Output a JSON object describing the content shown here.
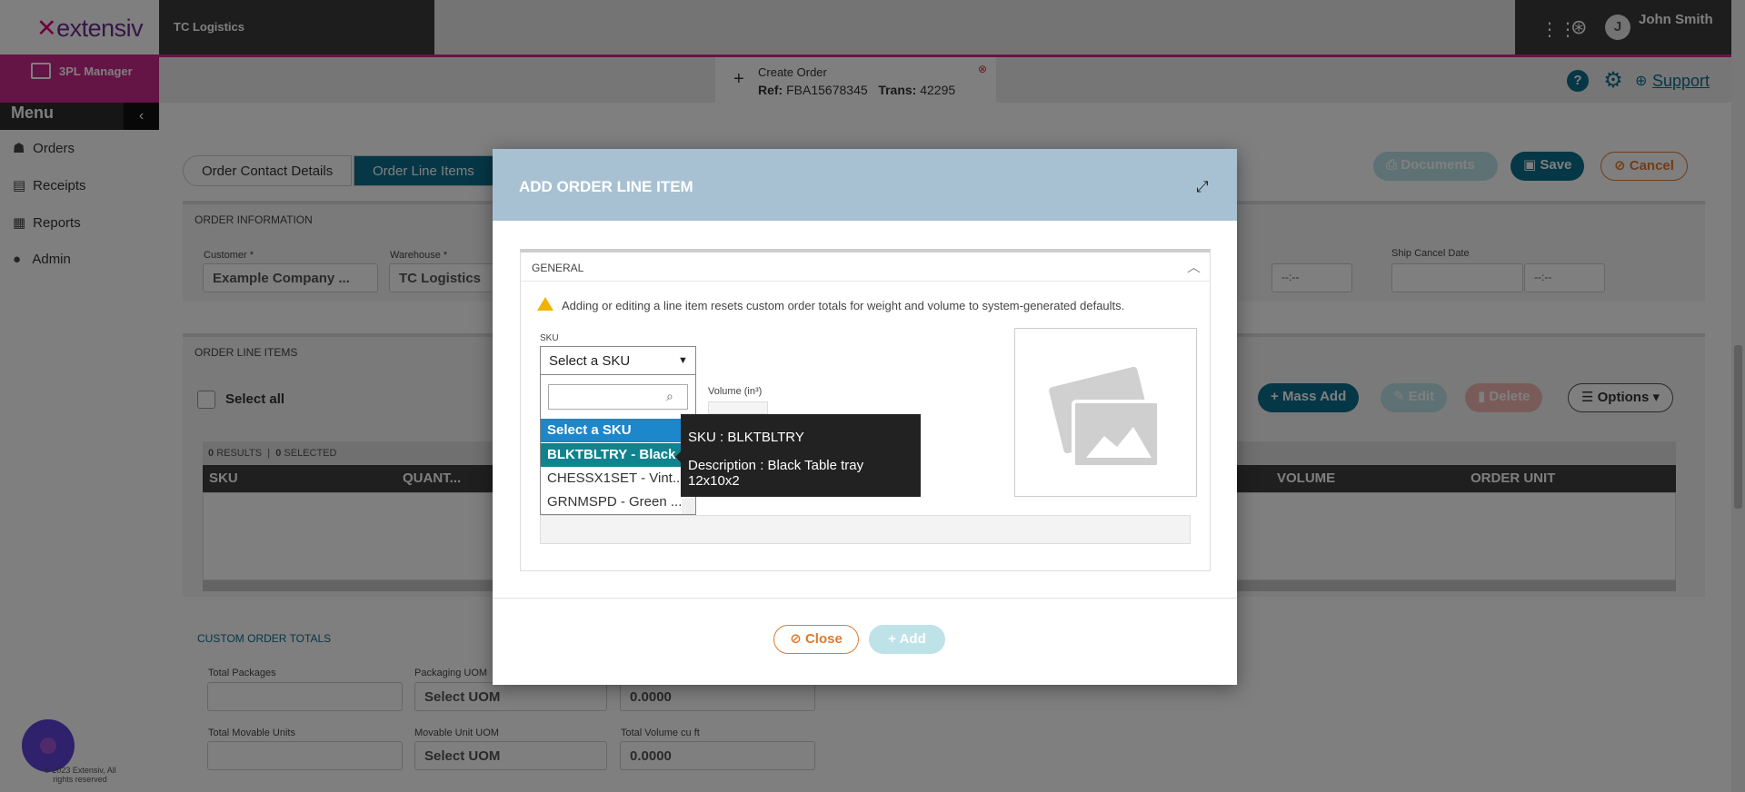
{
  "app": {
    "brand": "extensiv",
    "org": "TC Logistics",
    "user": {
      "name": "John Smith",
      "initial": "J"
    },
    "manager_label": "3PL Manager",
    "copyright": "© 2023 Extensiv, All rights reserved"
  },
  "sidebar": {
    "menu_label": "Menu",
    "items": [
      {
        "label": "Orders",
        "icon": "sitemap-icon"
      },
      {
        "label": "Receipts",
        "icon": "document-icon"
      },
      {
        "label": "Reports",
        "icon": "report-icon"
      },
      {
        "label": "Admin",
        "icon": "user-icon"
      }
    ]
  },
  "order_tab": {
    "title": "Create Order",
    "ref_label": "Ref:",
    "ref_value": "FBA15678345",
    "trans_label": "Trans:",
    "trans_value": "42295"
  },
  "header": {
    "support_label": "Support"
  },
  "tabs": [
    "Order Contact Details",
    "Order Line Items"
  ],
  "actions": {
    "documents": "Documents",
    "save": "Save",
    "cancel": "Cancel"
  },
  "order_info": {
    "title": "ORDER INFORMATION",
    "customer_label": "Customer *",
    "customer_value": "Example Company ...",
    "warehouse_label": "Warehouse *",
    "warehouse_value": "TC Logistics",
    "ship_cancel_label": "Ship Cancel Date",
    "time_placeholder": "--:--"
  },
  "line_items": {
    "title": "ORDER LINE ITEMS",
    "select_all": "Select all",
    "results_count": "0",
    "results_label": "RESULTS",
    "selected_count": "0",
    "selected_label": "SELECTED",
    "mass_add": "Mass Add",
    "edit": "Edit",
    "delete": "Delete",
    "options": "Options",
    "columns": [
      "SKU",
      "QUANT...",
      "VOLUME",
      "ORDER UNIT"
    ]
  },
  "custom_totals": {
    "title": "CUSTOM ORDER TOTALS",
    "total_packages_label": "Total Packages",
    "packaging_uom_label": "Packaging UOM",
    "packaging_uom_value": "Select UOM",
    "value_top": "0.0000",
    "total_movable_label": "Total Movable Units",
    "movable_uom_label": "Movable Unit UOM",
    "movable_uom_value": "Select UOM",
    "total_volume_label": "Total Volume cu ft",
    "total_volume_value": "0.0000"
  },
  "modal": {
    "title": "ADD ORDER LINE ITEM",
    "section": "GENERAL",
    "warning": "Adding or editing a line item resets custom order totals for weight and volume to system-generated defaults.",
    "sku_label": "SKU",
    "sku_placeholder": "Select a SKU",
    "volume_label": "Volume (in³)",
    "options": [
      "Select a SKU",
      "BLKTBLTRY - Black...",
      "CHESSX1SET - Vint...",
      "GRNMSPD - Green ..."
    ],
    "tooltip_sku": "SKU : BLKTBLTRY",
    "tooltip_desc": "Description : Black Table tray 12x10x2",
    "close": "Close",
    "add": "Add"
  }
}
